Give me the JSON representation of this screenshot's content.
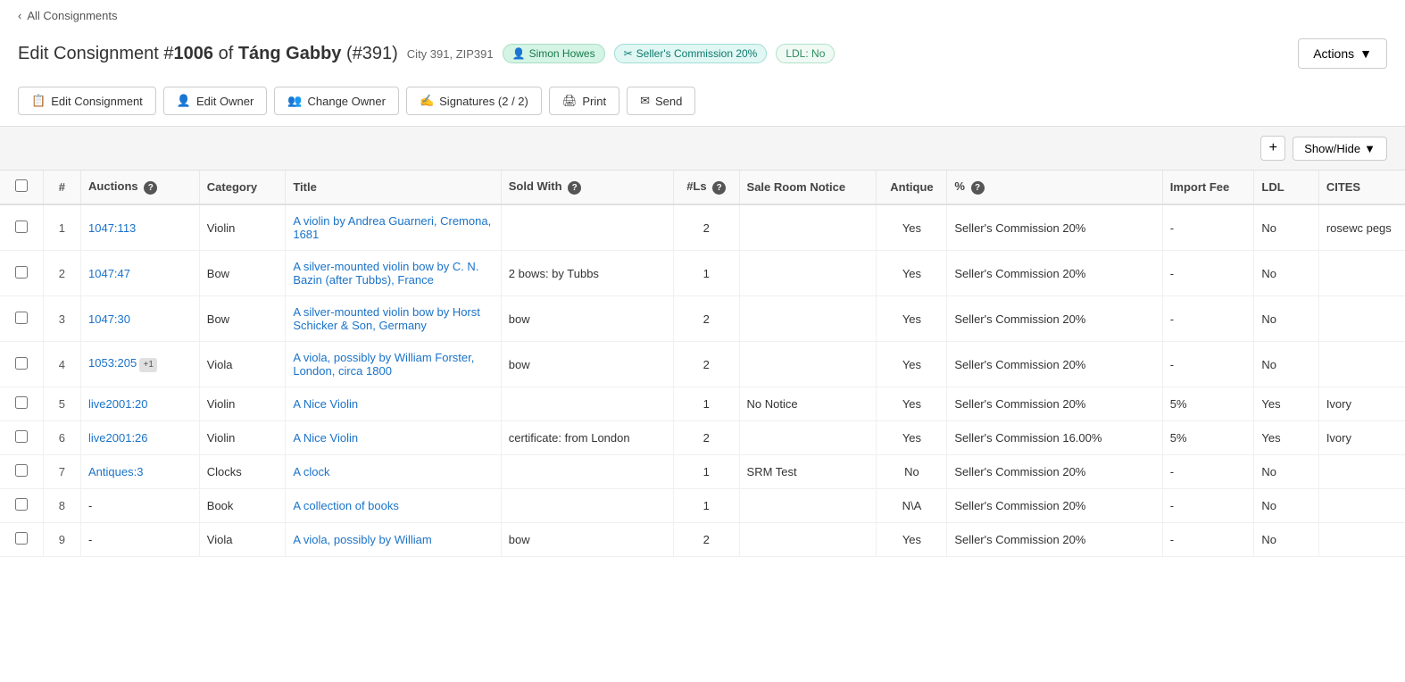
{
  "nav": {
    "back_label": "All Consignments"
  },
  "header": {
    "title_prefix": "Edit Consignment #",
    "consignment_num": "1006",
    "title_mid": " of ",
    "owner_name": "Táng Gabby",
    "owner_id": "(#391)",
    "location": "City 391, ZIP391",
    "badges": [
      {
        "id": "simon",
        "icon": "👤",
        "text": "Simon Howes"
      },
      {
        "id": "commission",
        "icon": "✂",
        "text": "Seller's Commission 20%"
      },
      {
        "id": "ldl",
        "text": "LDL: No"
      }
    ],
    "actions_label": "Actions"
  },
  "toolbar": {
    "buttons": [
      {
        "id": "edit-consignment",
        "icon": "📋",
        "label": "Edit Consignment"
      },
      {
        "id": "edit-owner",
        "icon": "👤",
        "label": "Edit Owner"
      },
      {
        "id": "change-owner",
        "icon": "👥",
        "label": "Change Owner"
      },
      {
        "id": "signatures",
        "icon": "✍",
        "label": "Signatures (2 / 2)"
      },
      {
        "id": "print",
        "icon": "🖨",
        "label": "Print"
      },
      {
        "id": "send",
        "icon": "✉",
        "label": "Send"
      }
    ]
  },
  "table_controls": {
    "add_label": "+",
    "show_hide_label": "Show/Hide"
  },
  "table": {
    "columns": [
      {
        "id": "checkbox",
        "label": ""
      },
      {
        "id": "num",
        "label": "#"
      },
      {
        "id": "auctions",
        "label": "Auctions",
        "has_help": true
      },
      {
        "id": "category",
        "label": "Category"
      },
      {
        "id": "title",
        "label": "Title"
      },
      {
        "id": "soldwith",
        "label": "Sold With",
        "has_help": true
      },
      {
        "id": "ls",
        "label": "#Ls",
        "has_help": true
      },
      {
        "id": "srn",
        "label": "Sale Room Notice"
      },
      {
        "id": "antique",
        "label": "Antique"
      },
      {
        "id": "pct",
        "label": "%",
        "has_help": true
      },
      {
        "id": "importfee",
        "label": "Import Fee"
      },
      {
        "id": "ldl",
        "label": "LDL"
      },
      {
        "id": "cites",
        "label": "CITES"
      }
    ],
    "rows": [
      {
        "num": "1",
        "auctions": "1047:113",
        "auction_plus": null,
        "category": "Violin",
        "title": "A violin by Andrea Guarneri, Cremona, 1681",
        "sold_with": "",
        "ls": "2",
        "srn": "",
        "antique": "Yes",
        "pct": "Seller's Commission 20%",
        "import_fee": "-",
        "ldl": "No",
        "cites": "rosewc pegs"
      },
      {
        "num": "2",
        "auctions": "1047:47",
        "auction_plus": null,
        "category": "Bow",
        "title": "A silver-mounted violin bow by C. N. Bazin (after Tubbs), France",
        "sold_with": "2 bows: by Tubbs",
        "ls": "1",
        "srn": "",
        "antique": "Yes",
        "pct": "Seller's Commission 20%",
        "import_fee": "-",
        "ldl": "No",
        "cites": ""
      },
      {
        "num": "3",
        "auctions": "1047:30",
        "auction_plus": null,
        "category": "Bow",
        "title": "A silver-mounted violin bow by Horst Schicker & Son, Germany",
        "sold_with": "bow",
        "ls": "2",
        "srn": "",
        "antique": "Yes",
        "pct": "Seller's Commission 20%",
        "import_fee": "-",
        "ldl": "No",
        "cites": ""
      },
      {
        "num": "4",
        "auctions": "1053:205",
        "auction_plus": "+1",
        "category": "Viola",
        "title": "A viola, possibly by William Forster, London, circa 1800",
        "sold_with": "bow",
        "ls": "2",
        "srn": "",
        "antique": "Yes",
        "pct": "Seller's Commission 20%",
        "import_fee": "-",
        "ldl": "No",
        "cites": ""
      },
      {
        "num": "5",
        "auctions": "live2001:20",
        "auction_plus": null,
        "category": "Violin",
        "title": "A Nice Violin",
        "sold_with": "",
        "ls": "1",
        "srn": "No Notice",
        "antique": "Yes",
        "pct": "Seller's Commission 20%",
        "import_fee": "5%",
        "ldl": "Yes",
        "cites": "Ivory"
      },
      {
        "num": "6",
        "auctions": "live2001:26",
        "auction_plus": null,
        "category": "Violin",
        "title": "A Nice Violin",
        "sold_with": "certificate: from London",
        "ls": "2",
        "srn": "",
        "antique": "Yes",
        "pct": "Seller's Commission 16.00%",
        "import_fee": "5%",
        "ldl": "Yes",
        "cites": "Ivory"
      },
      {
        "num": "7",
        "auctions": "Antiques:3",
        "auction_plus": null,
        "category": "Clocks",
        "title": "A clock",
        "sold_with": "",
        "ls": "1",
        "srn": "SRM Test",
        "antique": "No",
        "pct": "Seller's Commission 20%",
        "import_fee": "-",
        "ldl": "No",
        "cites": ""
      },
      {
        "num": "8",
        "auctions": "-",
        "auction_plus": null,
        "category": "Book",
        "title": "A collection of books",
        "sold_with": "",
        "ls": "1",
        "srn": "",
        "antique": "N\\A",
        "pct": "Seller's Commission 20%",
        "import_fee": "-",
        "ldl": "No",
        "cites": ""
      },
      {
        "num": "9",
        "auctions": "-",
        "auction_plus": null,
        "category": "Viola",
        "title": "A viola, possibly by William",
        "sold_with": "bow",
        "ls": "2",
        "srn": "",
        "antique": "Yes",
        "pct": "Seller's Commission 20%",
        "import_fee": "-",
        "ldl": "No",
        "cites": ""
      }
    ]
  }
}
